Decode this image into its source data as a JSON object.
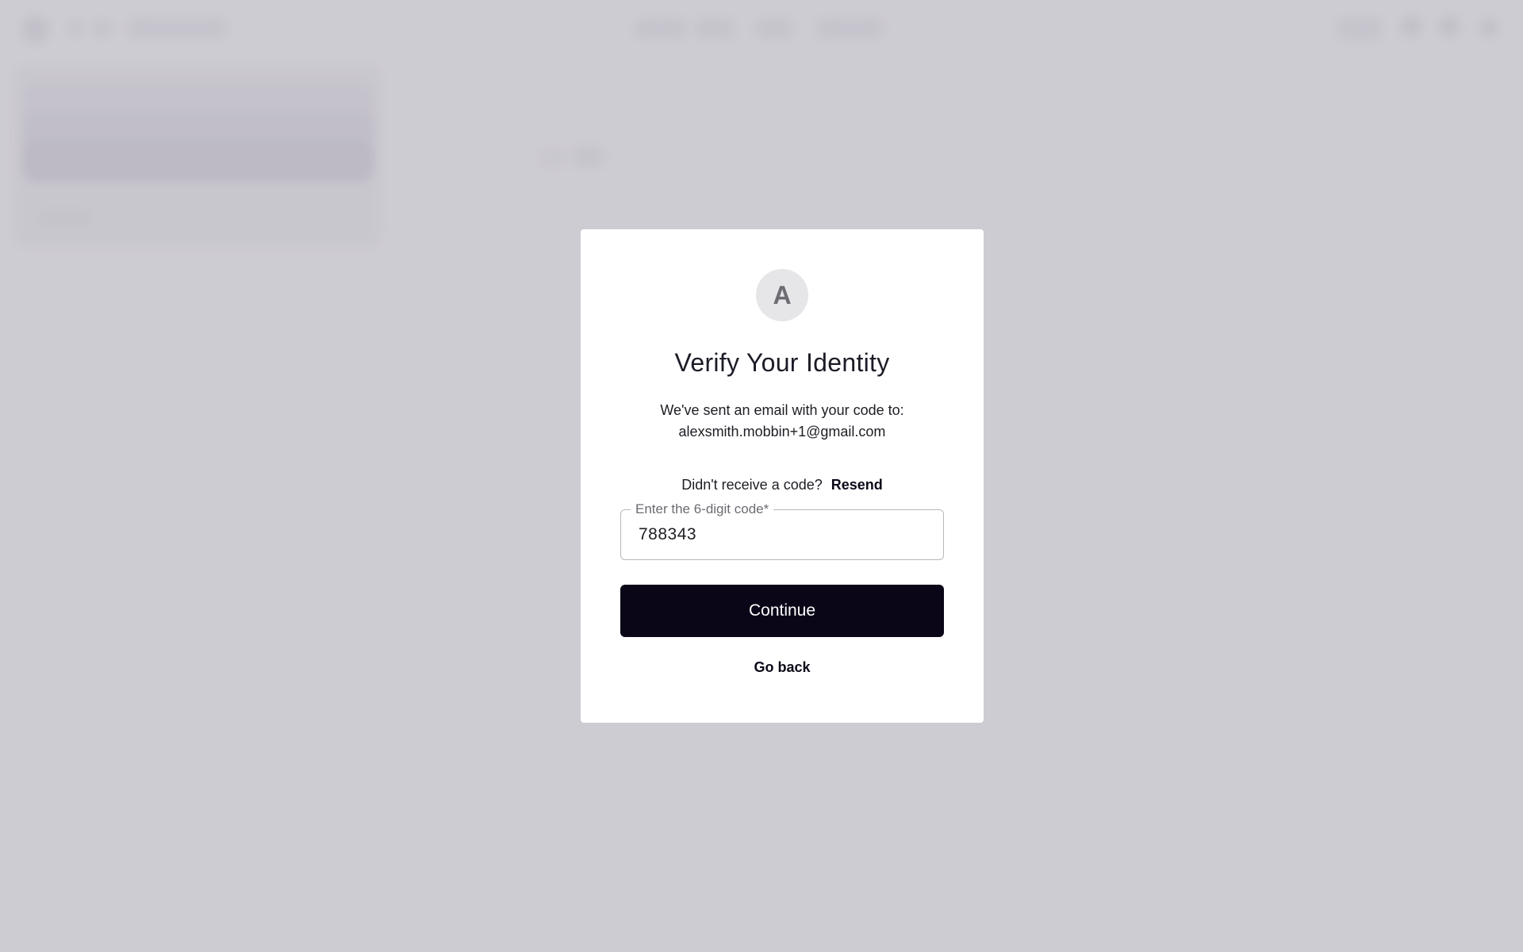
{
  "background": {
    "note_visible": false
  },
  "modal": {
    "avatar_letter": "A",
    "title": "Verify Your Identity",
    "subtitle_line1": "We've sent an email with your code to:",
    "subtitle_line2": "alexsmith.mobbin+1@gmail.com",
    "resend_prompt": "Didn't receive a code?",
    "resend_label": "Resend",
    "code_field": {
      "label": "Enter the 6-digit code*",
      "value": "788343"
    },
    "continue_label": "Continue",
    "go_back_label": "Go back"
  },
  "colors": {
    "backdrop": "#d0cfd4",
    "primary_button": "#0b0617",
    "avatar_bg": "#e6e5e8"
  }
}
